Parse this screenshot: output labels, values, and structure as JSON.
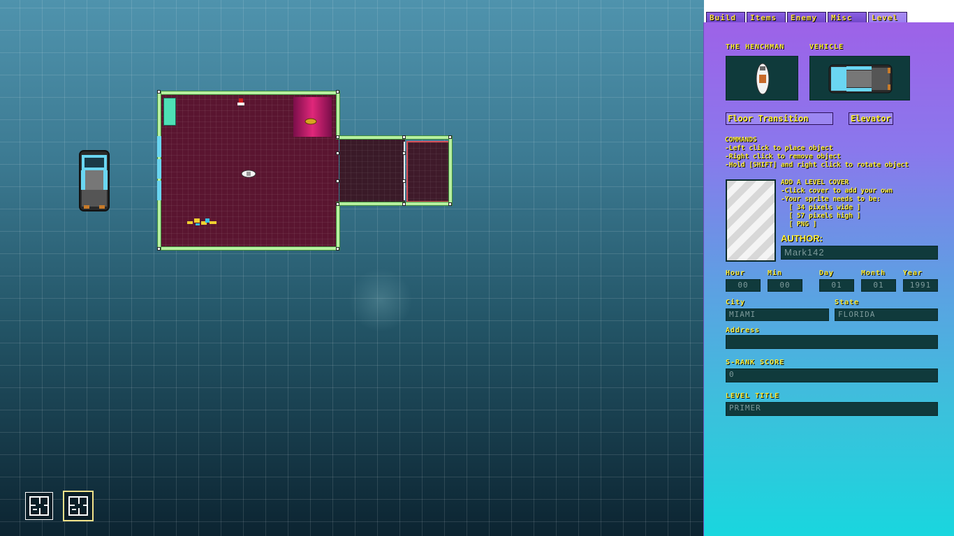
{
  "tabs": [
    {
      "label": "Build"
    },
    {
      "label": "Items"
    },
    {
      "label": "Enemy"
    },
    {
      "label": "Misc"
    },
    {
      "label": "Level"
    }
  ],
  "active_tab": "Level",
  "panel": {
    "henchman_label": "THE HENCHMAN",
    "vehicle_label": "VEHICLE",
    "floor_transition_label": "Floor Transition",
    "elevator_label": "Elevator",
    "commands_title": "COMMANDS",
    "commands": [
      "-Left click to place object",
      "-Right click to remove object",
      "-Hold [SHIFT] and right click to rotate object"
    ],
    "cover_title": "ADD A LEVEL COVER",
    "cover_lines": [
      "-Click cover to add your own",
      "-Your sprite needs to be:",
      "  [ 34 pixels wide ]",
      "  [ 57 pixels high ]",
      "  [ PNG ]"
    ],
    "author_label": "AUTHOR:",
    "author_value": "Mark142",
    "hour_label": "Hour",
    "hour_value": "00",
    "min_label": "Min",
    "min_value": "00",
    "day_label": "Day",
    "day_value": "01",
    "month_label": "Month",
    "month_value": "01",
    "year_label": "Year",
    "year_value": "1991",
    "city_label": "City",
    "city_value": "MIAMI",
    "state_label": "State",
    "state_value": "FLORIDA",
    "address_label": "Address",
    "address_value": "",
    "srank_label": "S-RANK SCORE",
    "srank_value": "0",
    "level_title_label": "LEVEL TITLE",
    "level_title_value": "PRIMER"
  },
  "colors": {
    "floor": "#5a1530",
    "wall": "#b7f0a0",
    "text_yellow": "#ffef3a",
    "field_bg": "#103a3c"
  }
}
